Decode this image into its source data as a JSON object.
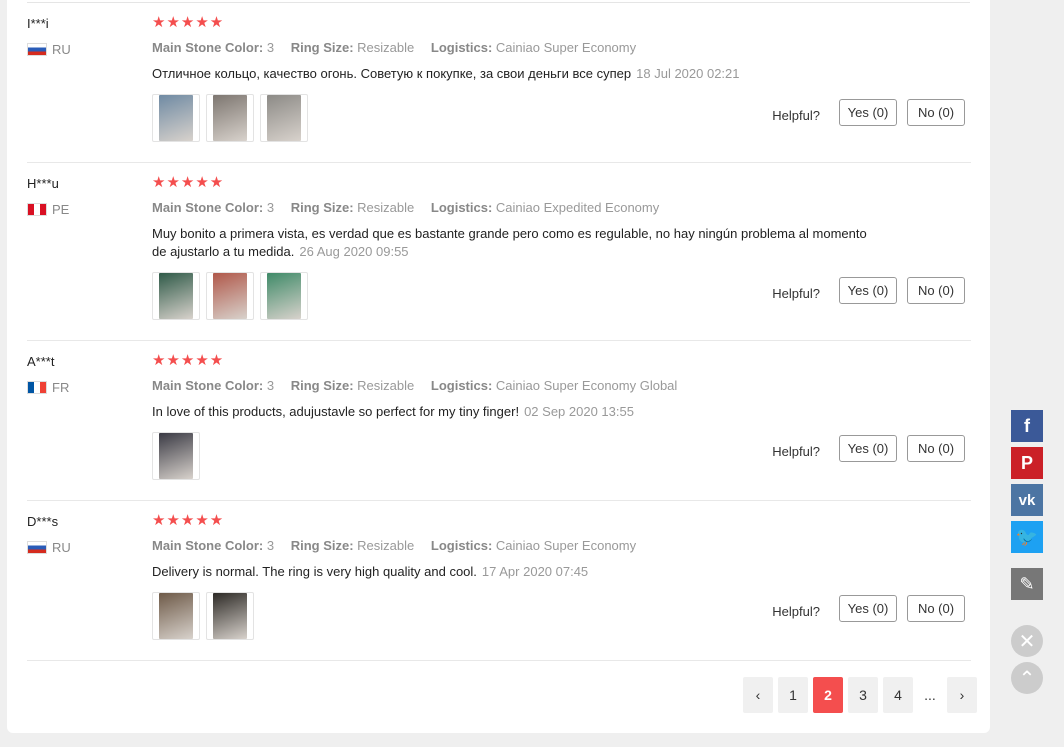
{
  "reviews": [
    {
      "user": "I***i",
      "country": "RU",
      "flag": "ru",
      "stars": "★★★★★",
      "stone_label": "Main Stone Color:",
      "stone_value": "3",
      "size_label": "Ring Size:",
      "size_value": "Resizable",
      "logistics_label": "Logistics:",
      "logistics_value": "Cainiao Super Economy",
      "text": "Отличное кольцо, качество огонь. Советую к покупке, за свои деньги все супер",
      "date": "18 Jul 2020 02:21",
      "helpful_label": "Helpful?",
      "yes_label": "Yes (0)",
      "no_label": "No (0)",
      "photo_colors": [
        "#6f8aa3",
        "#7d7670",
        "#8c8a86"
      ]
    },
    {
      "user": "H***u",
      "country": "PE",
      "flag": "pe",
      "stars": "★★★★★",
      "stone_label": "Main Stone Color:",
      "stone_value": "3",
      "size_label": "Ring Size:",
      "size_value": "Resizable",
      "logistics_label": "Logistics:",
      "logistics_value": "Cainiao Expedited Economy",
      "text": "Muy bonito a primera vista, es verdad que es bastante grande pero como es regulable, no hay ningún problema al momento de ajustarlo a tu medida.",
      "date": "26 Aug 2020 09:55",
      "helpful_label": "Helpful?",
      "yes_label": "Yes (0)",
      "no_label": "No (0)",
      "photo_colors": [
        "#2f5a48",
        "#b0584a",
        "#3f8a68"
      ]
    },
    {
      "user": "A***t",
      "country": "FR",
      "flag": "fr",
      "stars": "★★★★★",
      "stone_label": "Main Stone Color:",
      "stone_value": "3",
      "size_label": "Ring Size:",
      "size_value": "Resizable",
      "logistics_label": "Logistics:",
      "logistics_value": "Cainiao Super Economy Global",
      "text": "In love of this products, adujustavle so perfect for my tiny finger!",
      "date": "02 Sep 2020 13:55",
      "helpful_label": "Helpful?",
      "yes_label": "Yes (0)",
      "no_label": "No (0)",
      "photo_colors": [
        "#3a3a44"
      ]
    },
    {
      "user": "D***s",
      "country": "RU",
      "flag": "ru",
      "stars": "★★★★★",
      "stone_label": "Main Stone Color:",
      "stone_value": "3",
      "size_label": "Ring Size:",
      "size_value": "Resizable",
      "logistics_label": "Logistics:",
      "logistics_value": "Cainiao Super Economy",
      "text": "Delivery is normal. The ring is very high quality and cool.",
      "date": "17 Apr 2020 07:45",
      "helpful_label": "Helpful?",
      "yes_label": "Yes (0)",
      "no_label": "No (0)",
      "photo_colors": [
        "#6e5a48",
        "#2d2a26"
      ]
    }
  ],
  "pagination": {
    "prev": "‹",
    "pages": [
      "1",
      "2",
      "3",
      "4"
    ],
    "active": "2",
    "ellipsis": "...",
    "next": "›"
  },
  "social": [
    {
      "name": "facebook-icon",
      "glyph": "f",
      "color": "#3b5998"
    },
    {
      "name": "pinterest-icon",
      "glyph": "P",
      "color": "#cb2027"
    },
    {
      "name": "vk-icon",
      "glyph": "vk",
      "color": "#4c75a3"
    },
    {
      "name": "twitter-icon",
      "glyph": "🐦",
      "color": "#1da1f2"
    },
    {
      "name": "edit-icon",
      "glyph": "✎",
      "color": "#777777"
    }
  ],
  "close_glyph": "✕",
  "scroll_top_glyph": "⌃"
}
